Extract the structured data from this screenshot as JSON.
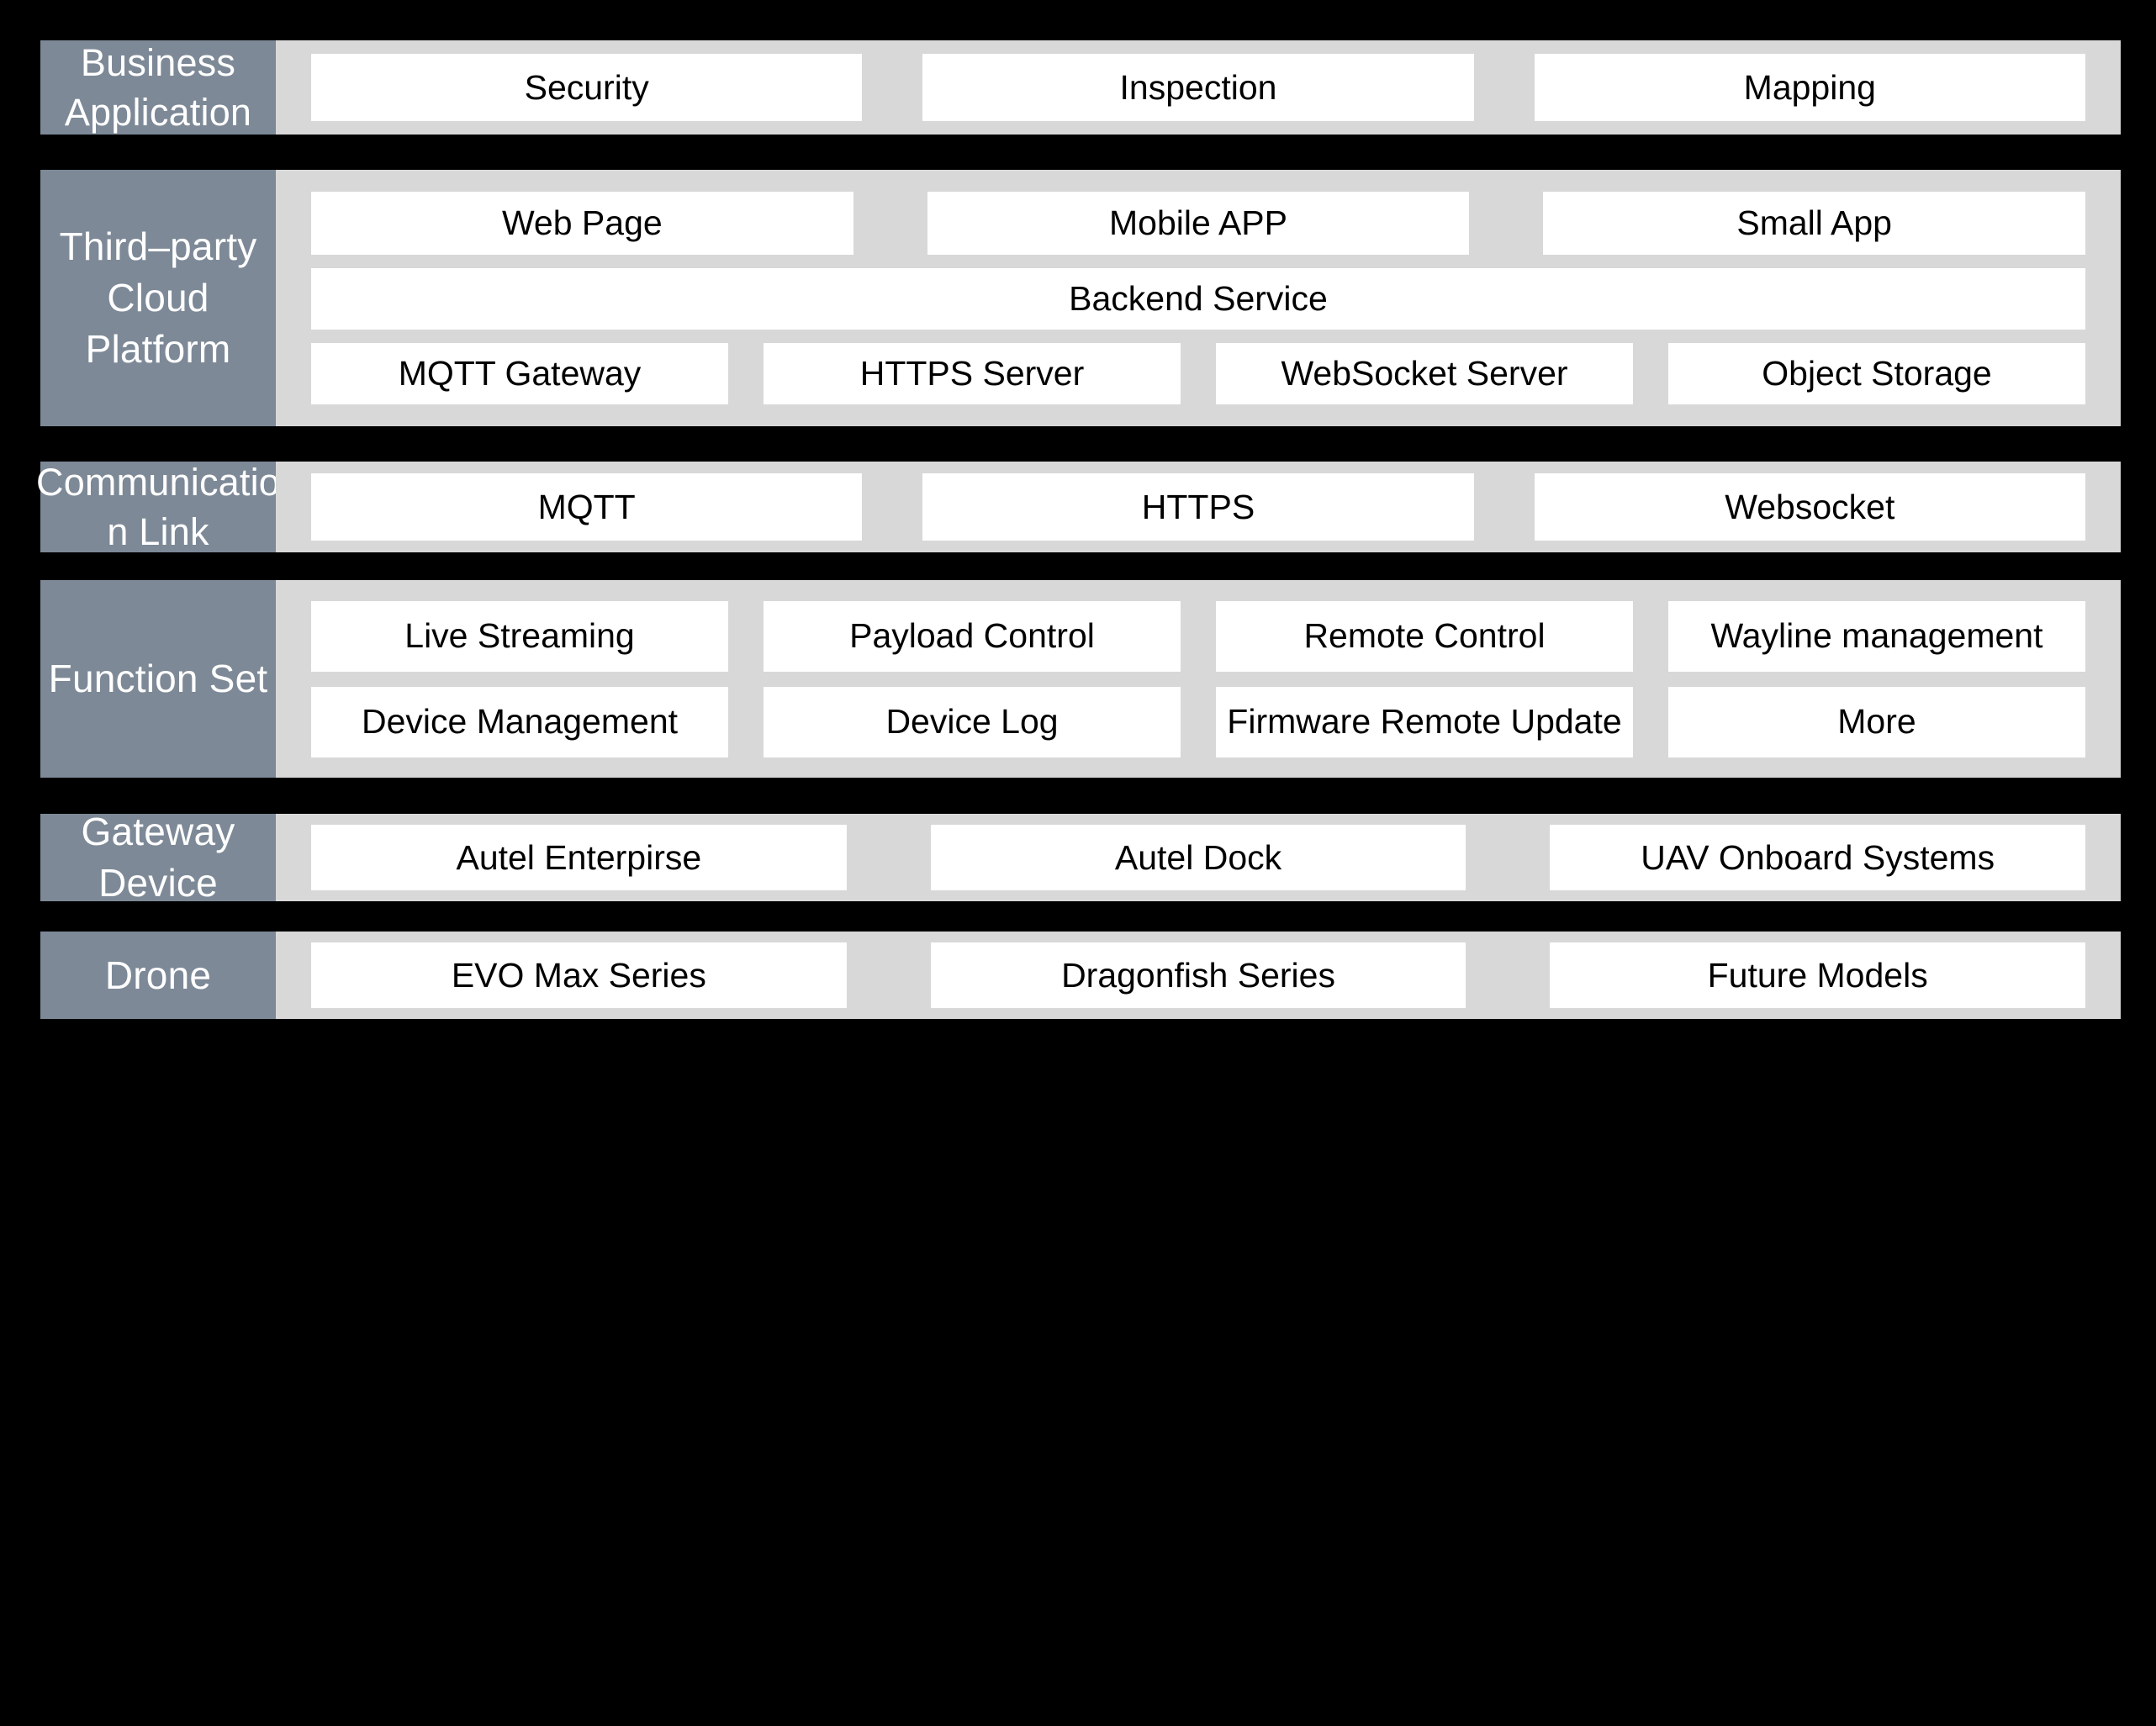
{
  "colors": {
    "background": "#000000",
    "layer_label_fill": "#7d8997",
    "layer_body_fill": "#d8d8d8",
    "node_fill": "#ffffff",
    "node_text": "#000000",
    "layer_label_text": "#ffffff"
  },
  "layers": [
    {
      "id": "business",
      "label": "Business Application",
      "rows": [
        {
          "nodes": [
            {
              "label": "Security"
            },
            {
              "label": "Inspection"
            },
            {
              "label": "Mapping"
            }
          ]
        }
      ]
    },
    {
      "id": "cloud",
      "label": "Third–party Cloud Platform",
      "rows": [
        {
          "nodes": [
            {
              "label": "Web Page"
            },
            {
              "label": "Mobile APP"
            },
            {
              "label": "Small App"
            }
          ]
        },
        {
          "nodes": [
            {
              "label": "Backend Service"
            }
          ]
        },
        {
          "nodes": [
            {
              "label": "MQTT Gateway"
            },
            {
              "label": "HTTPS Server"
            },
            {
              "label": "WebSocket Server"
            },
            {
              "label": "Object Storage"
            }
          ]
        }
      ]
    },
    {
      "id": "comm",
      "label": "Communicatio n Link",
      "rows": [
        {
          "nodes": [
            {
              "label": "MQTT"
            },
            {
              "label": "HTTPS"
            },
            {
              "label": "Websocket"
            }
          ]
        }
      ]
    },
    {
      "id": "function",
      "label": "Function Set",
      "rows": [
        {
          "nodes": [
            {
              "label": "Live Streaming"
            },
            {
              "label": "Payload Control"
            },
            {
              "label": "Remote Control"
            },
            {
              "label": "Wayline management"
            }
          ]
        },
        {
          "nodes": [
            {
              "label": "Device Management"
            },
            {
              "label": "Device Log"
            },
            {
              "label": "Firmware Remote Update"
            },
            {
              "label": "More"
            }
          ]
        }
      ]
    },
    {
      "id": "gateway",
      "label": "Gateway Device",
      "rows": [
        {
          "nodes": [
            {
              "label": "Autel Enterpirse"
            },
            {
              "label": "Autel Dock"
            },
            {
              "label": "UAV Onboard Systems"
            }
          ]
        }
      ]
    },
    {
      "id": "drone",
      "label": "Drone",
      "rows": [
        {
          "nodes": [
            {
              "label": "EVO Max Series"
            },
            {
              "label": "Dragonfish Series"
            },
            {
              "label": "Future Models"
            }
          ]
        }
      ]
    }
  ]
}
